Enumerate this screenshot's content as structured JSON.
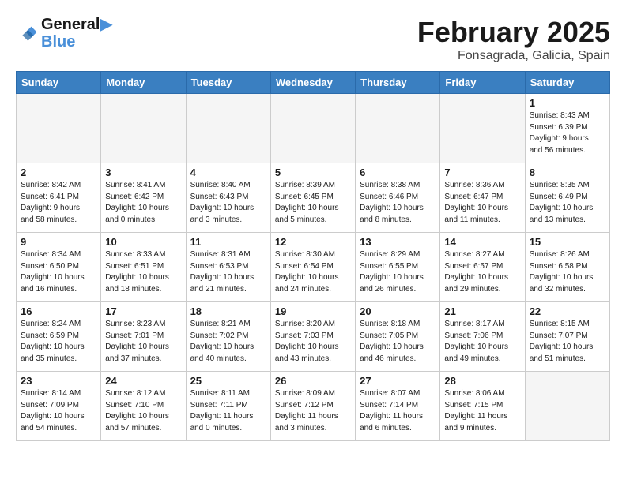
{
  "header": {
    "logo_line1": "General",
    "logo_line2": "Blue",
    "month_title": "February 2025",
    "subtitle": "Fonsagrada, Galicia, Spain"
  },
  "weekdays": [
    "Sunday",
    "Monday",
    "Tuesday",
    "Wednesday",
    "Thursday",
    "Friday",
    "Saturday"
  ],
  "weeks": [
    [
      {
        "day": "",
        "info": ""
      },
      {
        "day": "",
        "info": ""
      },
      {
        "day": "",
        "info": ""
      },
      {
        "day": "",
        "info": ""
      },
      {
        "day": "",
        "info": ""
      },
      {
        "day": "",
        "info": ""
      },
      {
        "day": "1",
        "info": "Sunrise: 8:43 AM\nSunset: 6:39 PM\nDaylight: 9 hours\nand 56 minutes."
      }
    ],
    [
      {
        "day": "2",
        "info": "Sunrise: 8:42 AM\nSunset: 6:41 PM\nDaylight: 9 hours\nand 58 minutes."
      },
      {
        "day": "3",
        "info": "Sunrise: 8:41 AM\nSunset: 6:42 PM\nDaylight: 10 hours\nand 0 minutes."
      },
      {
        "day": "4",
        "info": "Sunrise: 8:40 AM\nSunset: 6:43 PM\nDaylight: 10 hours\nand 3 minutes."
      },
      {
        "day": "5",
        "info": "Sunrise: 8:39 AM\nSunset: 6:45 PM\nDaylight: 10 hours\nand 5 minutes."
      },
      {
        "day": "6",
        "info": "Sunrise: 8:38 AM\nSunset: 6:46 PM\nDaylight: 10 hours\nand 8 minutes."
      },
      {
        "day": "7",
        "info": "Sunrise: 8:36 AM\nSunset: 6:47 PM\nDaylight: 10 hours\nand 11 minutes."
      },
      {
        "day": "8",
        "info": "Sunrise: 8:35 AM\nSunset: 6:49 PM\nDaylight: 10 hours\nand 13 minutes."
      }
    ],
    [
      {
        "day": "9",
        "info": "Sunrise: 8:34 AM\nSunset: 6:50 PM\nDaylight: 10 hours\nand 16 minutes."
      },
      {
        "day": "10",
        "info": "Sunrise: 8:33 AM\nSunset: 6:51 PM\nDaylight: 10 hours\nand 18 minutes."
      },
      {
        "day": "11",
        "info": "Sunrise: 8:31 AM\nSunset: 6:53 PM\nDaylight: 10 hours\nand 21 minutes."
      },
      {
        "day": "12",
        "info": "Sunrise: 8:30 AM\nSunset: 6:54 PM\nDaylight: 10 hours\nand 24 minutes."
      },
      {
        "day": "13",
        "info": "Sunrise: 8:29 AM\nSunset: 6:55 PM\nDaylight: 10 hours\nand 26 minutes."
      },
      {
        "day": "14",
        "info": "Sunrise: 8:27 AM\nSunset: 6:57 PM\nDaylight: 10 hours\nand 29 minutes."
      },
      {
        "day": "15",
        "info": "Sunrise: 8:26 AM\nSunset: 6:58 PM\nDaylight: 10 hours\nand 32 minutes."
      }
    ],
    [
      {
        "day": "16",
        "info": "Sunrise: 8:24 AM\nSunset: 6:59 PM\nDaylight: 10 hours\nand 35 minutes."
      },
      {
        "day": "17",
        "info": "Sunrise: 8:23 AM\nSunset: 7:01 PM\nDaylight: 10 hours\nand 37 minutes."
      },
      {
        "day": "18",
        "info": "Sunrise: 8:21 AM\nSunset: 7:02 PM\nDaylight: 10 hours\nand 40 minutes."
      },
      {
        "day": "19",
        "info": "Sunrise: 8:20 AM\nSunset: 7:03 PM\nDaylight: 10 hours\nand 43 minutes."
      },
      {
        "day": "20",
        "info": "Sunrise: 8:18 AM\nSunset: 7:05 PM\nDaylight: 10 hours\nand 46 minutes."
      },
      {
        "day": "21",
        "info": "Sunrise: 8:17 AM\nSunset: 7:06 PM\nDaylight: 10 hours\nand 49 minutes."
      },
      {
        "day": "22",
        "info": "Sunrise: 8:15 AM\nSunset: 7:07 PM\nDaylight: 10 hours\nand 51 minutes."
      }
    ],
    [
      {
        "day": "23",
        "info": "Sunrise: 8:14 AM\nSunset: 7:09 PM\nDaylight: 10 hours\nand 54 minutes."
      },
      {
        "day": "24",
        "info": "Sunrise: 8:12 AM\nSunset: 7:10 PM\nDaylight: 10 hours\nand 57 minutes."
      },
      {
        "day": "25",
        "info": "Sunrise: 8:11 AM\nSunset: 7:11 PM\nDaylight: 11 hours\nand 0 minutes."
      },
      {
        "day": "26",
        "info": "Sunrise: 8:09 AM\nSunset: 7:12 PM\nDaylight: 11 hours\nand 3 minutes."
      },
      {
        "day": "27",
        "info": "Sunrise: 8:07 AM\nSunset: 7:14 PM\nDaylight: 11 hours\nand 6 minutes."
      },
      {
        "day": "28",
        "info": "Sunrise: 8:06 AM\nSunset: 7:15 PM\nDaylight: 11 hours\nand 9 minutes."
      },
      {
        "day": "",
        "info": ""
      }
    ]
  ]
}
